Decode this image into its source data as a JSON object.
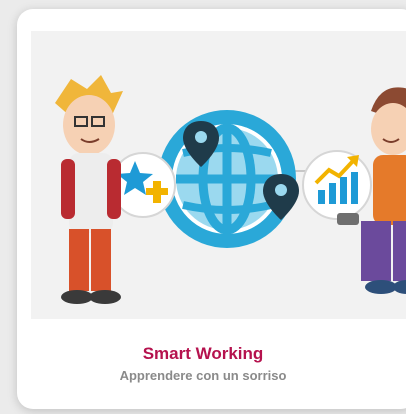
{
  "card": {
    "title": "Smart Working",
    "subtitle": "Apprendere con un sorriso"
  },
  "icons": [
    "globe-icon",
    "location-pin-icon",
    "star-plus-icon",
    "growth-chart-icon"
  ],
  "colors": {
    "title": "#b5124e",
    "subtitle": "#8a8a8a",
    "globe": "#2aa8d8",
    "pin": "#1f3b4a",
    "star": "#1e9ad6",
    "plus": "#f2b300",
    "arrow": "#f2b300",
    "bars": "#1e9ad6"
  }
}
